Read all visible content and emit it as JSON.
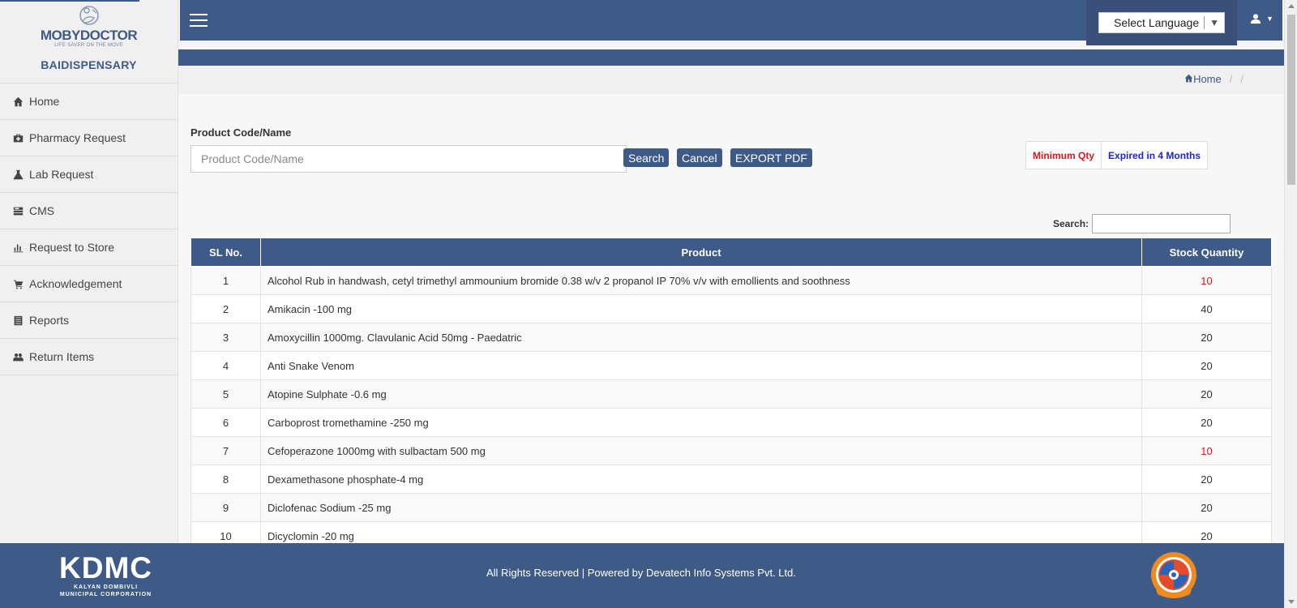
{
  "brand": {
    "name": "MOBYDOCTOR",
    "tagline": "LIFE SAVER ON THE MOVE",
    "dispensary": "BAIDISPENSARY"
  },
  "sidebar": {
    "items": [
      {
        "label": "Home",
        "icon": "home-icon"
      },
      {
        "label": "Pharmacy Request",
        "icon": "medkit-icon"
      },
      {
        "label": "Lab Request",
        "icon": "flask-icon"
      },
      {
        "label": "CMS",
        "icon": "tasks-icon"
      },
      {
        "label": "Request to Store",
        "icon": "bar-chart-icon"
      },
      {
        "label": "Acknowledgement",
        "icon": "cart-icon"
      },
      {
        "label": "Reports",
        "icon": "list-icon"
      },
      {
        "label": "Return Items",
        "icon": "users-icon"
      }
    ]
  },
  "header": {
    "language_label": "Select Language",
    "language_caret": "▼"
  },
  "breadcrumb": {
    "home": "Home",
    "separator": "/"
  },
  "form": {
    "label": "Product Code/Name",
    "placeholder": "Product Code/Name",
    "search_btn": "Search",
    "cancel_btn": "Cancel",
    "export_btn": "EXPORT PDF"
  },
  "legend": {
    "min_qty": "Minimum Qty",
    "expired": "Expired in 4 Months"
  },
  "table": {
    "search_label": "Search:",
    "headers": [
      "SL No.",
      "Product",
      "Stock Quantity"
    ],
    "rows": [
      {
        "sl": "1",
        "product": "Alcohol Rub in handwash, cetyl trimethyl ammounium bromide 0.38 w/v 2 propanol IP 70% v/v with emollients and soothness",
        "qty": "10",
        "low": true
      },
      {
        "sl": "2",
        "product": "Amikacin -100 mg",
        "qty": "40",
        "low": false
      },
      {
        "sl": "3",
        "product": "Amoxycillin 1000mg. Clavulanic Acid 50mg - Paedatric",
        "qty": "20",
        "low": false
      },
      {
        "sl": "4",
        "product": "Anti Snake Venom",
        "qty": "20",
        "low": false
      },
      {
        "sl": "5",
        "product": "Atopine Sulphate -0.6 mg",
        "qty": "20",
        "low": false
      },
      {
        "sl": "6",
        "product": "Carboprost tromethamine -250 mg",
        "qty": "20",
        "low": false
      },
      {
        "sl": "7",
        "product": "Cefoperazone 1000mg with sulbactam 500 mg",
        "qty": "10",
        "low": true
      },
      {
        "sl": "8",
        "product": "Dexamethasone phosphate-4 mg",
        "qty": "20",
        "low": false
      },
      {
        "sl": "9",
        "product": "Diclofenac Sodium -25 mg",
        "qty": "20",
        "low": false
      },
      {
        "sl": "10",
        "product": "Dicyclomin -20 mg",
        "qty": "20",
        "low": false
      }
    ]
  },
  "footer": {
    "kdmc": "KDMC",
    "kdmc_line1": "KALYAN DOMBIVLI",
    "kdmc_line2": "MUNICIPAL CORPORATION",
    "text": "All Rights Reserved | Powered by Devatech Info Systems Pvt. Ltd."
  },
  "colors": {
    "primary": "#3e5a87",
    "min_qty": "#e3141c",
    "expired": "#1f22d8"
  }
}
